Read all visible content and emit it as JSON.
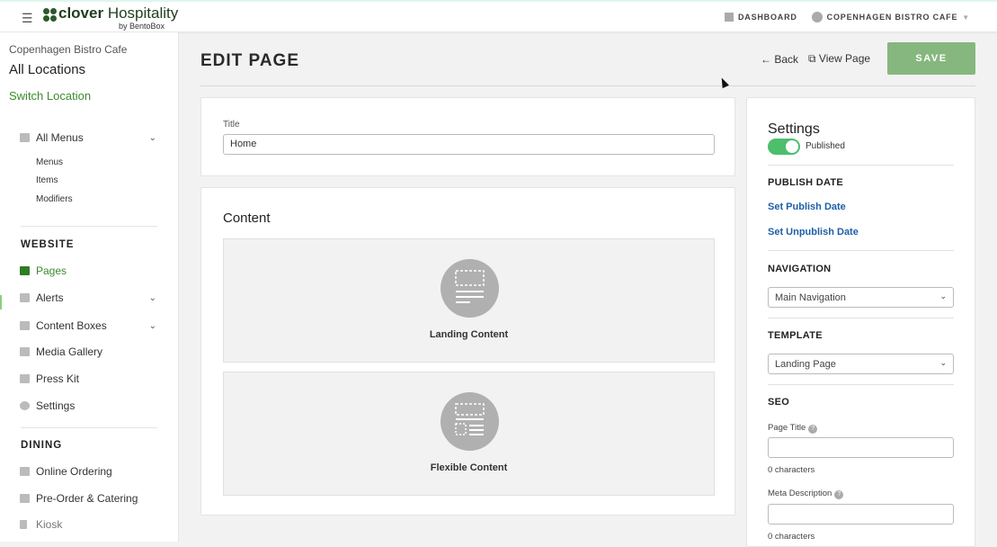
{
  "header": {
    "logo_main": "clover",
    "logo_secondary": "Hospitality",
    "logo_sub": "by BentoBox",
    "dashboard": "DASHBOARD",
    "account": "COPENHAGEN BISTRO CAFE"
  },
  "sidebar": {
    "location_name": "Copenhagen Bistro Cafe",
    "all_locations": "All Locations",
    "switch_location": "Switch Location",
    "all_menus": "All Menus",
    "menu_sub": [
      "Menus",
      "Items",
      "Modifiers"
    ],
    "website_header": "WEBSITE",
    "website_items": [
      "Pages",
      "Alerts",
      "Content Boxes",
      "Media Gallery",
      "Press Kit",
      "Settings"
    ],
    "dining_header": "DINING",
    "dining_items": [
      "Online Ordering",
      "Pre-Order & Catering",
      "Kiosk"
    ]
  },
  "main": {
    "page_title": "EDIT PAGE",
    "back": "Back",
    "view_page": "View Page",
    "save": "SAVE",
    "title_label": "Title",
    "title_value": "Home",
    "content_heading": "Content",
    "blocks": [
      "Landing Content",
      "Flexible Content"
    ]
  },
  "settings": {
    "heading": "Settings",
    "published_label": "Published",
    "published": true,
    "publish_date_header": "PUBLISH DATE",
    "set_publish": "Set Publish Date",
    "set_unpublish": "Set Unpublish Date",
    "navigation_header": "NAVIGATION",
    "navigation_value": "Main Navigation",
    "template_header": "TEMPLATE",
    "template_value": "Landing Page",
    "seo_header": "SEO",
    "page_title_label": "Page Title",
    "page_title_count": "0 characters",
    "meta_label": "Meta Description",
    "meta_count": "0 characters"
  },
  "colors": {
    "accent": "#3b8a2e",
    "save": "#86b77e",
    "toggle": "#4cbe6c",
    "link": "#1e5fa8"
  }
}
